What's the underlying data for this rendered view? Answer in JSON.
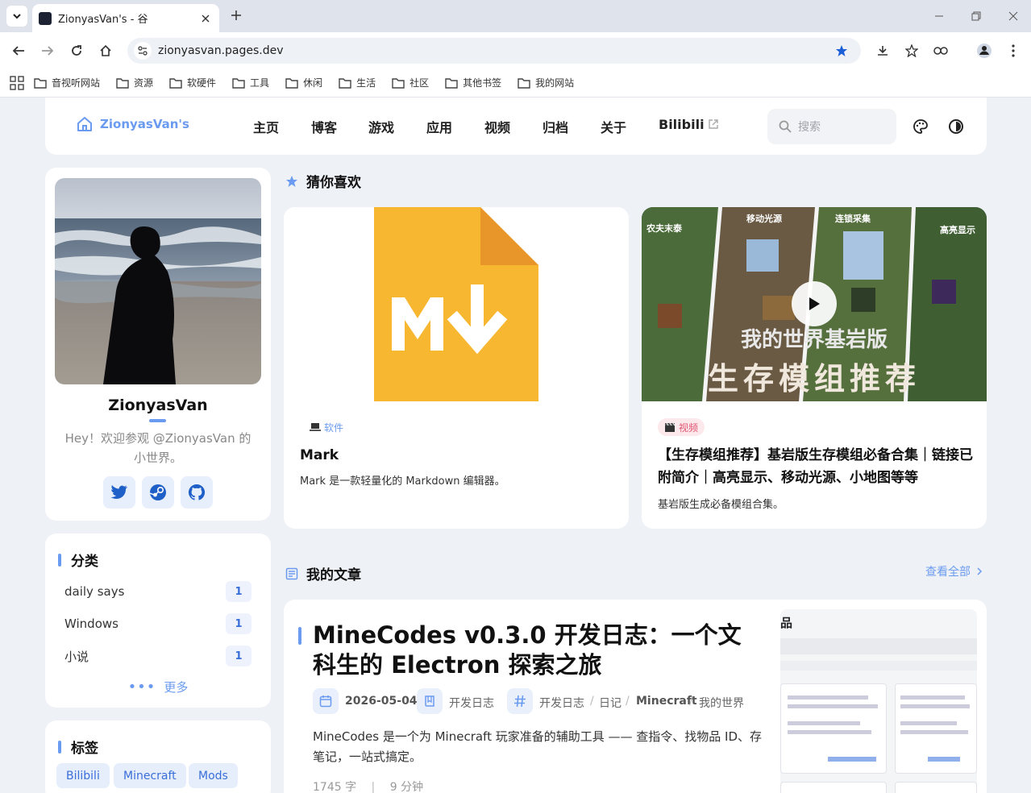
{
  "browser": {
    "tab_title": "ZionyasVan's - 谷",
    "url": "zionyasvan.pages.dev",
    "bookmarks": [
      "音视听网站",
      "资源",
      "软硬件",
      "工具",
      "休闲",
      "生活",
      "社区",
      "其他书签",
      "我的网站"
    ]
  },
  "site": {
    "brand": "ZionyasVan's",
    "nav": [
      "主页",
      "博客",
      "游戏",
      "应用",
      "视频",
      "归档",
      "关于",
      "Bilibili"
    ],
    "search_placeholder": "搜索"
  },
  "profile": {
    "name": "ZionyasVan",
    "bio": "Hey！欢迎参观 @ZionyasVan 的小世界。",
    "socials": [
      "twitter-icon",
      "steam-icon",
      "github-icon"
    ]
  },
  "categories": {
    "title": "分类",
    "items": [
      {
        "name": "daily says",
        "count": "1"
      },
      {
        "name": "Windows",
        "count": "1"
      },
      {
        "name": "小说",
        "count": "1"
      }
    ],
    "more": "更多"
  },
  "tags": {
    "title": "标签",
    "items": [
      "Bilibili",
      "Minecraft",
      "Mods"
    ]
  },
  "recommend": {
    "title": "猜你喜欢",
    "cards": [
      {
        "badge": "软件",
        "title": "Mark",
        "desc": "Mark 是一款轻量化的 Markdown 编辑器。"
      },
      {
        "badge": "视频",
        "title": "【生存模组推荐】基岩版生存模组必备合集｜链接已附简介｜高亮显示、移动光源、小地图等等",
        "desc": "基岩版生成必备模组合集。",
        "thumb_small_labels": [
          "农夫末泰",
          "移动光源",
          "连锁采集",
          "高亮显示"
        ],
        "thumb_line1": "我的世界基岩版",
        "thumb_line2": "生存模组推荐"
      }
    ]
  },
  "posts": {
    "title": "我的文章",
    "view_all": "查看全部",
    "items": [
      {
        "title": "MineCodes v0.3.0 开发日志：一个文科生的 Electron 探索之旅",
        "date": "2026-05-04",
        "category": "开发日志",
        "tags": [
          "开发日志",
          "日记",
          "Minecraft",
          "我的世界"
        ],
        "excerpt": "MineCodes 是一个为 Minecraft 玩家准备的辅助工具 —— 查指令、找物品 ID、存笔记，一站式搞定。",
        "words": "1745 字",
        "time": "9 分钟",
        "thumb_heading": "品"
      }
    ]
  },
  "colors": {
    "accent": "#6b9bf0",
    "md_icon": "#f7b731",
    "video_badge": "#e05570"
  }
}
